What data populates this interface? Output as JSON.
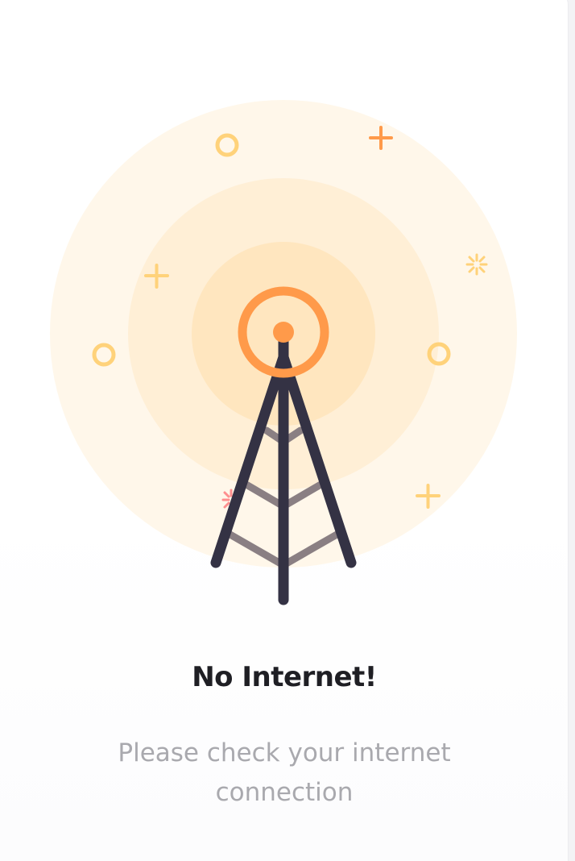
{
  "empty_state": {
    "title": "No Internet!",
    "message": "Please check your internet connection",
    "illustration": "signal-tower-icon"
  },
  "colors": {
    "outer_ring": "#fff7ea",
    "middle_ring": "#ffefd6",
    "inner_ring": "#ffe6bf",
    "signal": "#ff9a4a",
    "tower": "#343244",
    "tower_braces": "#8a7f83",
    "accent_yellow": "#ffd27a",
    "accent_pink": "#ff8f8f",
    "title": "#1f1f24",
    "message": "#a9a9ae"
  }
}
